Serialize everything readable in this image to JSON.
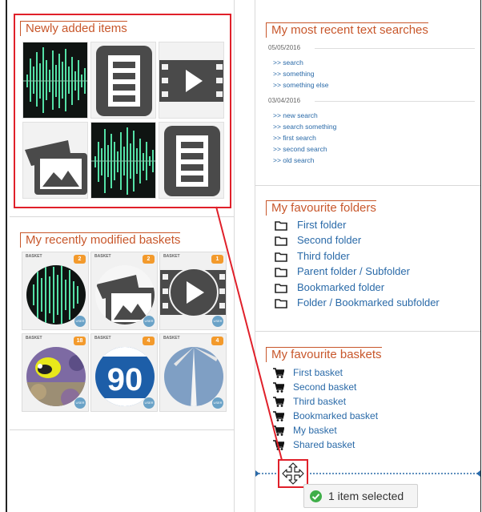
{
  "panels": {
    "newly_added": {
      "title": "Newly added items"
    },
    "recent_baskets": {
      "title": "My recently modified baskets",
      "tile_label": "BASKET",
      "user_badge": "USER",
      "counts": [
        "2",
        "2",
        "1",
        "18",
        "4",
        "4"
      ]
    },
    "recent_searches": {
      "title": "My most recent text searches",
      "groups": [
        {
          "date": "05/05/2016",
          "items": [
            ">> search",
            ">> something",
            ">> something else"
          ]
        },
        {
          "date": "03/04/2016",
          "items": [
            ">> new search",
            ">> search something",
            ">> first search",
            ">> second search",
            ">> old search"
          ]
        }
      ]
    },
    "favourite_folders": {
      "title": "My favourite folders",
      "items": [
        "First folder",
        "Second folder",
        "Third folder",
        "Parent folder / Subfolder",
        "Bookmarked folder",
        "Folder / Bookmarked subfolder"
      ]
    },
    "favourite_baskets": {
      "title": "My favourite baskets",
      "items": [
        "First basket",
        "Second basket",
        "Third basket",
        "Bookmarked basket",
        "My basket",
        "Shared basket"
      ]
    }
  },
  "thumbnail_text": {
    "highway_number": "90"
  },
  "drag": {
    "icon": "move-cursor-icon"
  },
  "toast": {
    "text": "1 item selected",
    "icon": "check-circle-icon"
  },
  "colors": {
    "accent_orange": "#c8572b",
    "link_blue": "#2a6aa8",
    "highlight_red": "#e0202a",
    "badge_orange": "#f39a2c",
    "success_green": "#3fae49"
  }
}
